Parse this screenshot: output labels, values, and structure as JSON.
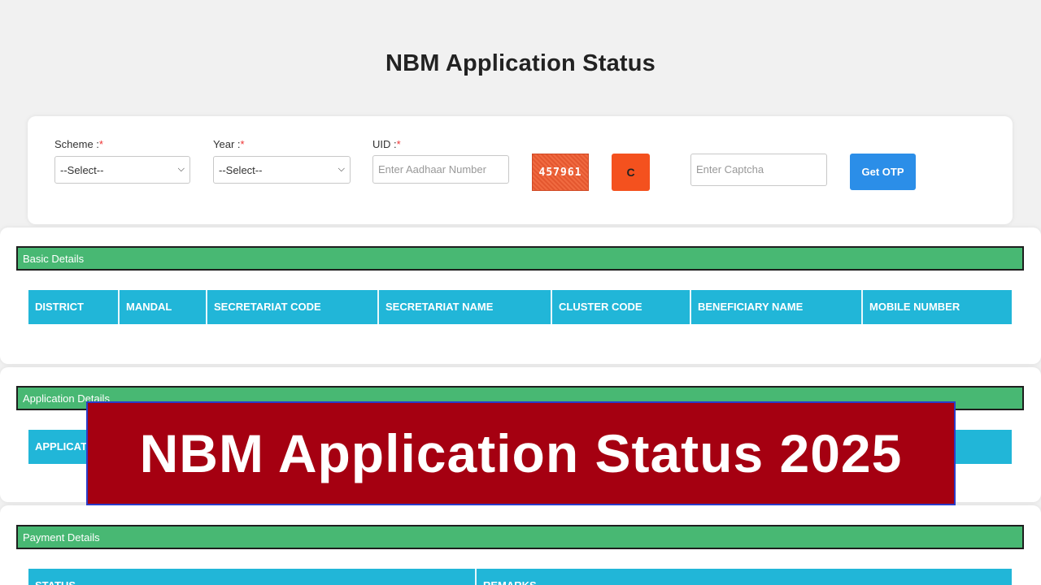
{
  "page": {
    "title": "NBM Application Status"
  },
  "search_form": {
    "scheme_label": "Scheme :",
    "year_label": "Year :",
    "uid_label": "UID :",
    "required_mark": "*",
    "scheme_value": "--Select--",
    "year_value": "--Select--",
    "uid_placeholder": "Enter Aadhaar Number",
    "captcha_text": "457961",
    "refresh_label": "C",
    "captcha_placeholder": "Enter Captcha",
    "otp_button": "Get OTP"
  },
  "sections": {
    "basic": {
      "title": "Basic Details",
      "columns": [
        "DISTRICT",
        "MANDAL",
        "SECRETARIAT CODE",
        "SECRETARIAT NAME",
        "CLUSTER CODE",
        "BENEFICIARY NAME",
        "MOBILE NUMBER"
      ]
    },
    "application": {
      "title": "Application Details",
      "columns": [
        "APPLICATION"
      ]
    },
    "payment": {
      "title": "Payment Details",
      "columns": [
        "STATUS",
        "REMARKS"
      ]
    }
  },
  "banner": {
    "text": "NBM Application Status 2025"
  },
  "colors": {
    "section_bar": "#48b873",
    "table_header": "#21b6d8",
    "refresh_button": "#f4511e",
    "otp_button": "#2b8ee8",
    "banner": "#a50011"
  },
  "icons": {
    "select_chevron": "chevron-down-icon",
    "refresh": "refresh-icon"
  }
}
